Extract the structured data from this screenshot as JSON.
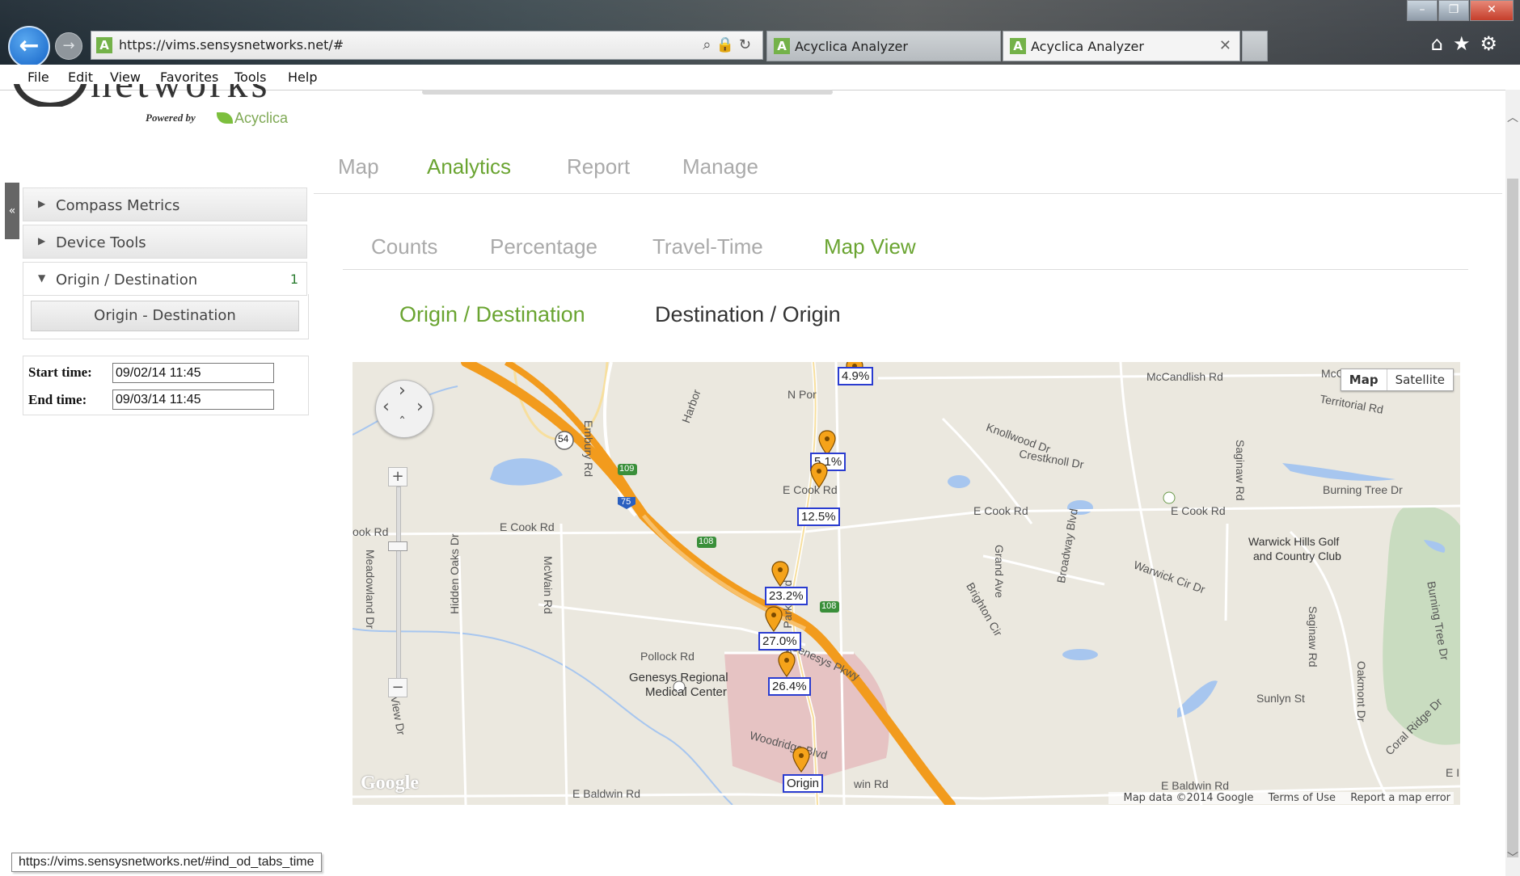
{
  "browser": {
    "url": "https://vims.sensysnetworks.net/#",
    "tabs": [
      {
        "label": "Acyclica Analyzer"
      },
      {
        "label": "Acyclica Analyzer"
      }
    ],
    "close_glyph": "✕",
    "menu": [
      "File",
      "Edit",
      "View",
      "Favorites",
      "Tools",
      "Help"
    ],
    "status_url": "https://vims.sensysnetworks.net/#ind_od_tabs_time"
  },
  "header": {
    "logo_word": "networks",
    "powered_by": "Powered by",
    "partner": "Acyclica"
  },
  "nav": {
    "main": [
      "Map",
      "Analytics",
      "Report",
      "Manage"
    ],
    "main_active": "Analytics",
    "sub": [
      "Counts",
      "Percentage",
      "Travel-Time",
      "Map View"
    ],
    "sub_active": "Map View",
    "od": [
      "Origin / Destination",
      "Destination / Origin"
    ],
    "od_active": "Origin / Destination"
  },
  "sidebar": {
    "collapse_glyph": "«",
    "sections": [
      {
        "label": "Compass Metrics",
        "expanded": false
      },
      {
        "label": "Device Tools",
        "expanded": false
      },
      {
        "label": "Origin / Destination",
        "expanded": true,
        "count": "1"
      }
    ],
    "od_button": "Origin - Destination",
    "start_label": "Start time:",
    "start_value": "09/02/14 11:45",
    "end_label": "End time:",
    "end_value": "09/03/14 11:45"
  },
  "map": {
    "map_type": [
      "Map",
      "Satellite"
    ],
    "zoom_in": "+",
    "zoom_out": "−",
    "streets": [
      "McCandlish Rd",
      "McC",
      "Territorial Rd",
      "N Por",
      "Embury Rd",
      "Harbor",
      "Knollwood Dr",
      "Crestknoll Dr",
      "E Cook Rd",
      "E Cook Rd",
      "E Cook Rd",
      "ook Rd",
      "E Cook Rd",
      "Saginaw Rd",
      "Burning Tree Dr",
      "Warwick Hills Golf",
      "and Country Club",
      "Warwick Cir Dr",
      "Grand Ave",
      "Broadway Blvd",
      "Brighton Cir",
      "Meadowland Dr",
      "Hidden Oaks Dr",
      "McWain Rd",
      "Pollock Rd",
      "Genesys Regional",
      "Medical Center",
      "Health Park Blvd",
      "Genesys Pkwy",
      "Woodridge Blvd",
      "Sunlyn St",
      "Saginaw Rd",
      "Oakmont Dr",
      "Coral Ridge Dr",
      "Burning Tree Dr",
      "E Baldwin Rd",
      "E Baldwin Rd",
      "win Rd",
      "E I",
      "View Dr"
    ],
    "route_shields": [
      "54",
      "109",
      "75",
      "108",
      "108"
    ],
    "markers": [
      {
        "label": "4.9%"
      },
      {
        "label": "5.1%"
      },
      {
        "label": "12.5%"
      },
      {
        "label": "23.2%"
      },
      {
        "label": "27.0%"
      },
      {
        "label": "26.4%"
      },
      {
        "label": "Origin"
      }
    ],
    "google_logo": "Google",
    "attribution": [
      "Map data ©2014 Google",
      "Terms of Use",
      "Report a map error"
    ],
    "colors": {
      "highway": "#f29b1d",
      "land": "#ebe8df",
      "water": "#a7c6ef",
      "park": "#c9dcc0",
      "hospital": "#e6c3c3",
      "pin": "#f5a31a",
      "label_border": "#2a3cd0"
    }
  }
}
